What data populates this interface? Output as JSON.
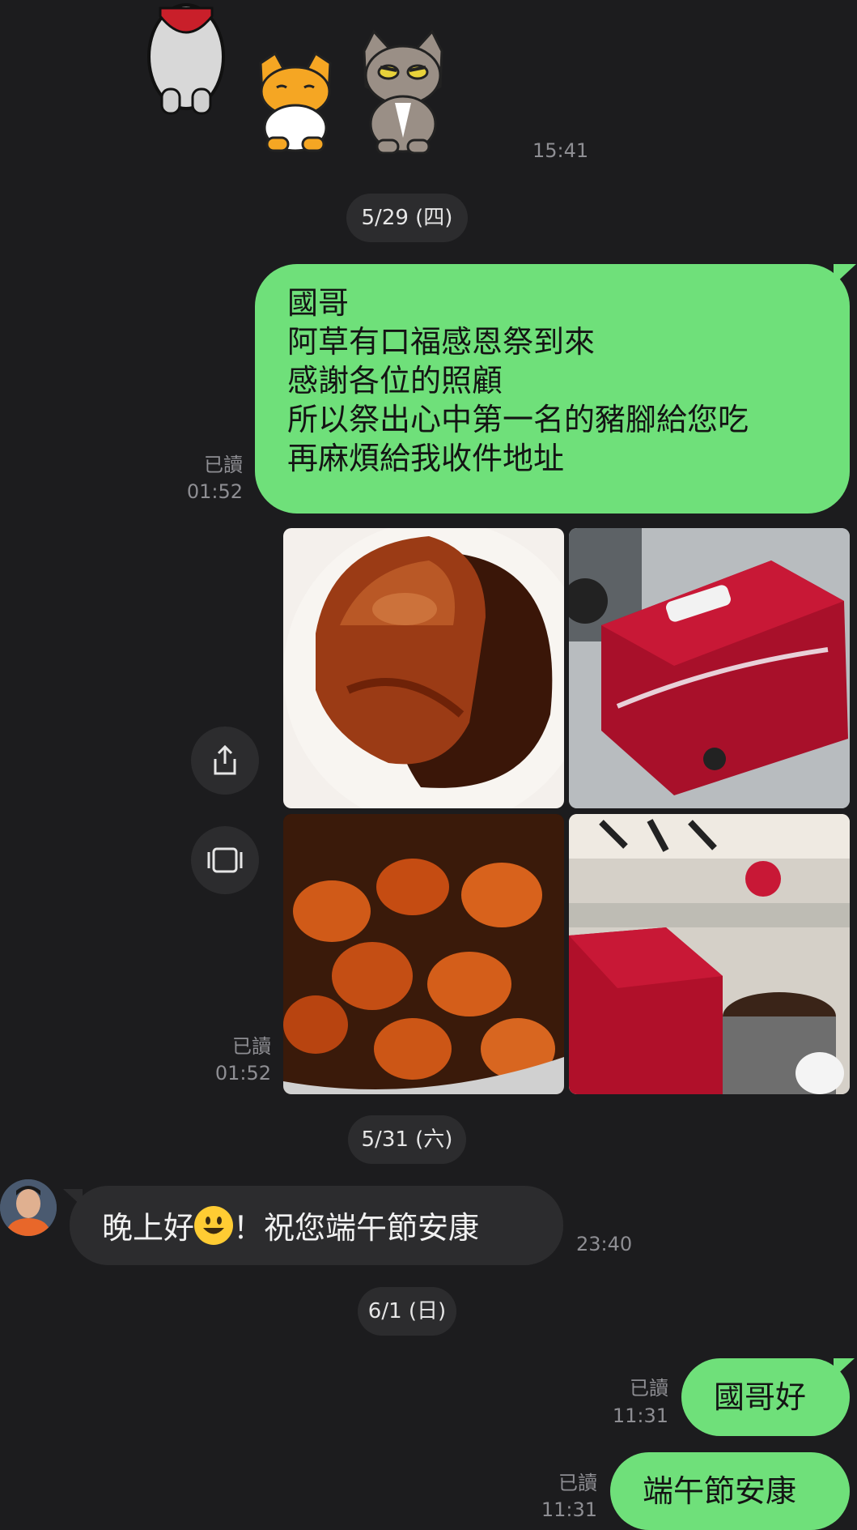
{
  "stickers": {
    "time": "15:41",
    "items": [
      "rabbit-sticker",
      "orange-cat-sticker",
      "gray-cat-sticker"
    ]
  },
  "date_1": "5/29 (四)",
  "msg_1": {
    "lines": [
      "國哥",
      "阿草有口福感恩祭到來",
      "感謝各位的照顧",
      "所以祭出心中第一名的豬腳給您吃",
      "再麻煩給我收件地址"
    ],
    "read": "已讀",
    "time": "01:52"
  },
  "photos": {
    "read": "已讀",
    "time": "01:52",
    "items": [
      "braised-pork-knuckle-photo",
      "red-gift-box-photo",
      "pot-of-pork-knuckles-photo",
      "gift-box-in-shop-photo"
    ],
    "share_icon": "share-icon",
    "expand_icon": "expand-icon"
  },
  "date_2": "5/31 (六)",
  "msg_2": {
    "before": "晚上好",
    "emoji": "smiling-face-emoji",
    "after": "！祝您端午節安康",
    "time": "23:40"
  },
  "date_3": "6/1 (日)",
  "msg_3": {
    "text": "國哥好",
    "read": "已讀",
    "time": "11:31"
  },
  "msg_4": {
    "text": "端午節安康",
    "read": "已讀",
    "time": "11:31"
  },
  "colors": {
    "background": "#1c1c1e",
    "outgoing_bubble": "#6fe07a",
    "incoming_bubble": "#2c2c2e",
    "meta_text": "#8e8e93"
  }
}
